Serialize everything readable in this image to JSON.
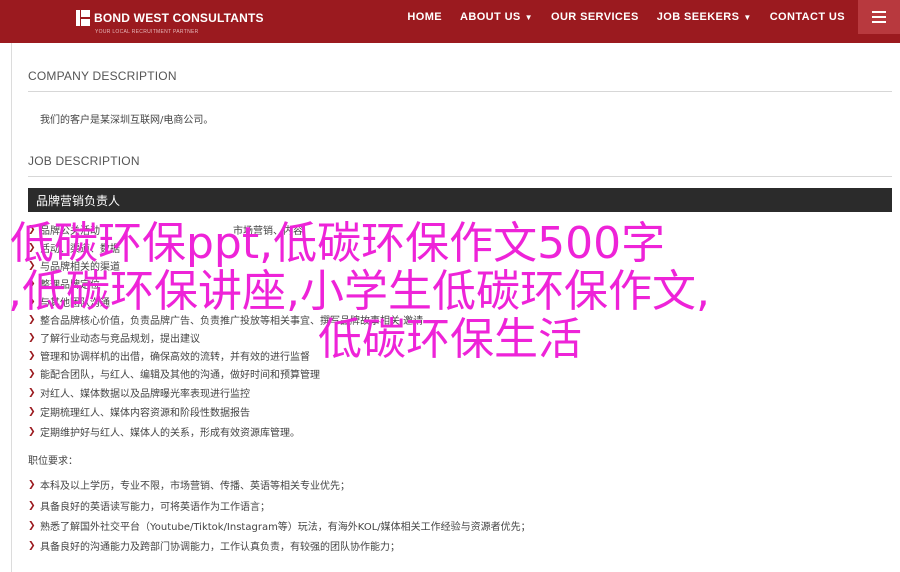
{
  "header": {
    "logo_text": "BOND WEST CONSULTANTS",
    "logo_tagline": "YOUR LOCAL RECRUITMENT PARTNER",
    "nav": [
      {
        "label": "HOME",
        "has_dropdown": false
      },
      {
        "label": "ABOUT US",
        "has_dropdown": true
      },
      {
        "label": "OUR SERVICES",
        "has_dropdown": false
      },
      {
        "label": "JOB SEEKERS",
        "has_dropdown": true
      },
      {
        "label": "CONTACT US",
        "has_dropdown": false
      }
    ],
    "colors": {
      "header_bg": "#9b1a1f",
      "accent": "#ee23d8"
    }
  },
  "company": {
    "title": "COMPANY DESCRIPTION",
    "text": "我们的客户是某深圳互联网/电商公司。"
  },
  "job": {
    "title": "JOB DESCRIPTION",
    "position": "品牌营销负责人",
    "responsibilities": [
      "品牌公关活动",
      "市场营销、内容",
      "活动、渠道、数据",
      "与品牌相关的渠道",
      "整理品牌定位",
      "与其他团队沟通",
      "整合品牌核心价值，负责品牌广告、负责推广投放等相关事宜、撰写品牌故事相关 邀请",
      "了解行业动态与竞品规划，提出建议",
      "管理和协调样机的出借，确保高效的流转，并有效的进行监督",
      "能配合团队，与红人、编辑及其他的沟通，做好时间和预算管理",
      "对红人、媒体数据以及品牌曝光率表现进行监控",
      "定期梳理红人、媒体内容资源和阶段性数据报告",
      "定期维护好与红人、媒体人的关系，形成有效资源库管理。"
    ],
    "requirements_title": "职位要求：",
    "requirements": [
      "本科及以上学历，专业不限，市场营销、传播、英语等相关专业优先；",
      "具备良好的英语读写能力，可将英语作为工作语言；",
      "熟悉了解国外社交平台（Youtube/Tiktok/Instagram等）玩法，有海外KOL/媒体相关工作经验与资源者优先；",
      "具备良好的沟通能力及跨部门协调能力，工作认真负责，有较强的团队协作能力；"
    ]
  },
  "overlay": {
    "line1": "低碳环保ppt,低碳环保作文500字",
    "line2": ",低碳环保讲座,小学生低碳环保作文,",
    "line3": "低碳环保生活"
  }
}
